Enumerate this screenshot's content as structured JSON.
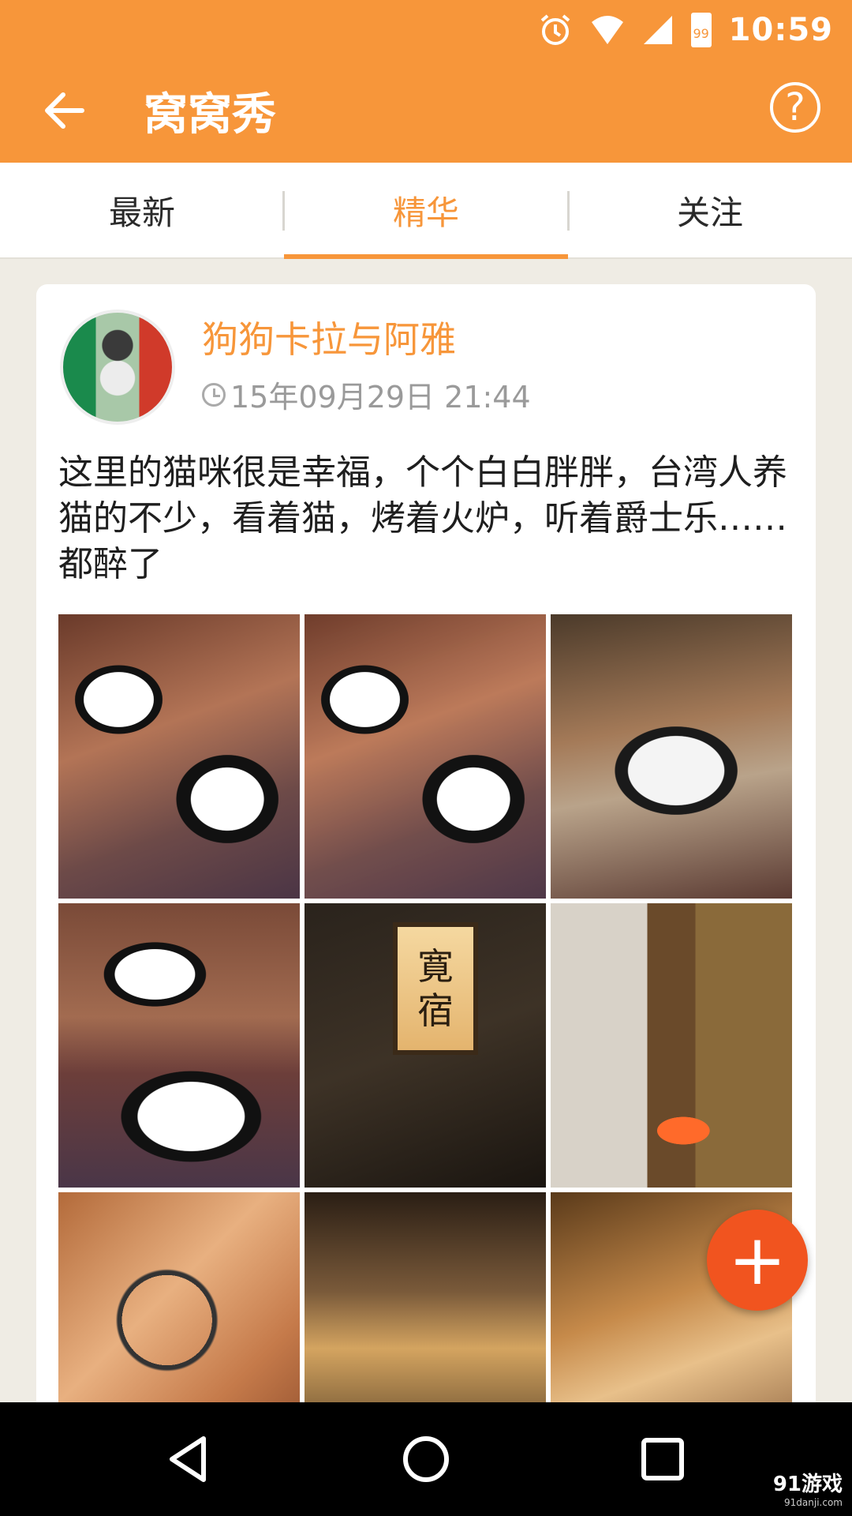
{
  "status_bar": {
    "time": "10:59",
    "battery": "99"
  },
  "header": {
    "title": "窝窝秀",
    "help_label": "?"
  },
  "tabs": [
    {
      "label": "最新",
      "active": false
    },
    {
      "label": "精华",
      "active": true
    },
    {
      "label": "关注",
      "active": false
    }
  ],
  "post": {
    "username": "狗狗卡拉与阿雅",
    "timestamp": "15年09月29日 21:44",
    "text": "这里的猫咪很是幸福，个个白白胖胖，台湾人养猫的不少，看着猫，烤着火炉，听着爵士乐……都醉了",
    "photos": [
      {
        "name": "photo-cats-1"
      },
      {
        "name": "photo-cats-2"
      },
      {
        "name": "photo-cat-3"
      },
      {
        "name": "photo-cats-4"
      },
      {
        "name": "photo-sign",
        "sign_text_1": "寛",
        "sign_text_2": "宿"
      },
      {
        "name": "photo-stove"
      },
      {
        "name": "photo-bike"
      },
      {
        "name": "photo-bar"
      },
      {
        "name": "photo-shop"
      }
    ]
  },
  "fab": {
    "label": "+"
  },
  "watermark": {
    "brand": "91游戏",
    "site": "91danji.com"
  },
  "colors": {
    "accent": "#f7963a",
    "fab": "#f1541f"
  }
}
